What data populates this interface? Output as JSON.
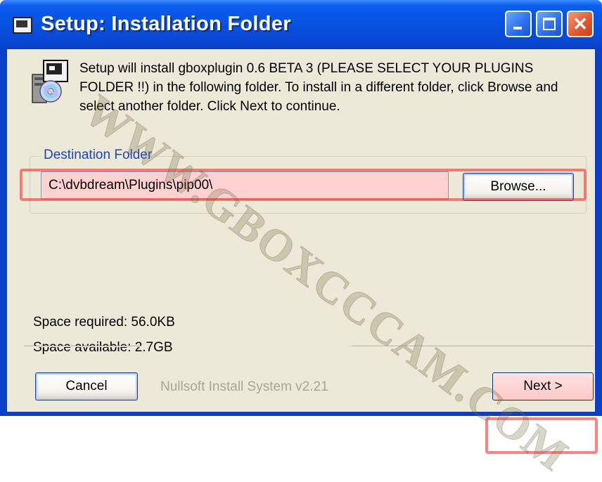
{
  "window": {
    "title": "Setup: Installation Folder",
    "controls": {
      "minimize": "minimize-icon",
      "maximize": "maximize-icon",
      "close": "close-icon"
    }
  },
  "header": {
    "text": "Setup will install gboxplugin 0.6 BETA 3 (PLEASE SELECT YOUR PLUGINS FOLDER !!) in the following folder. To install in a different folder, click Browse and select another folder. Click Next to continue.",
    "icon": "installer-icon"
  },
  "destination": {
    "group_label": "Destination Folder",
    "path": "C:\\dvbdream\\Plugins\\pip00\\",
    "browse_label": "Browse..."
  },
  "space": {
    "required": "Space required: 56.0KB",
    "available": "Space available: 2.7GB"
  },
  "footer": {
    "branding": "Nullsoft Install System v2.21",
    "cancel_label": "Cancel",
    "next_label": "Next >"
  },
  "watermark": "WWW.GBOXCCCAM.COM",
  "colors": {
    "titlebar": "#0751e0",
    "client": "#ece9d8",
    "group_label": "#1c47b5",
    "highlight": "#ff1e1e",
    "input_highlight_fill": "#ffd1d1"
  }
}
